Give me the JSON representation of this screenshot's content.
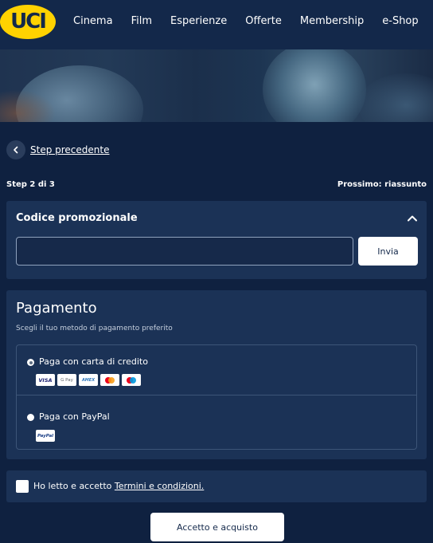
{
  "header": {
    "logo_text": "UCI",
    "nav": [
      "Cinema",
      "Film",
      "Esperienze",
      "Offerte",
      "Membership",
      "e-Shop"
    ]
  },
  "back_link": {
    "label": "Step precedente"
  },
  "steps": {
    "current": "Step 2 di 3",
    "next": "Prossimo: riassunto"
  },
  "promo": {
    "title": "Codice promozionale",
    "input_value": "",
    "button_label": "Invia"
  },
  "payment": {
    "title": "Pagamento",
    "subtitle": "Scegli il tuo metodo di pagamento preferito",
    "methods": [
      {
        "label": "Paga con carta di credito",
        "selected": true,
        "cards": [
          "VISA",
          "G Pay",
          "AMEX",
          "Mastercard",
          "Maestro"
        ]
      },
      {
        "label": "Paga con PayPal",
        "selected": false,
        "badge": "PayPal"
      }
    ]
  },
  "terms": {
    "prefix": "Ho letto e accetto ",
    "link": "Termini e condizioni.",
    "checked": false
  },
  "submit_label": "Accetto e acquisto",
  "colors": {
    "background": "#0f2140",
    "header": "#13284a",
    "panel": "#1b3256",
    "logo_yellow": "#ffd200",
    "visa_blue": "#1a1f71",
    "amex_blue": "#2e77bc",
    "mastercard_red": "#eb001b",
    "mastercard_orange": "#f79e1b",
    "maestro_blue": "#0099df"
  }
}
